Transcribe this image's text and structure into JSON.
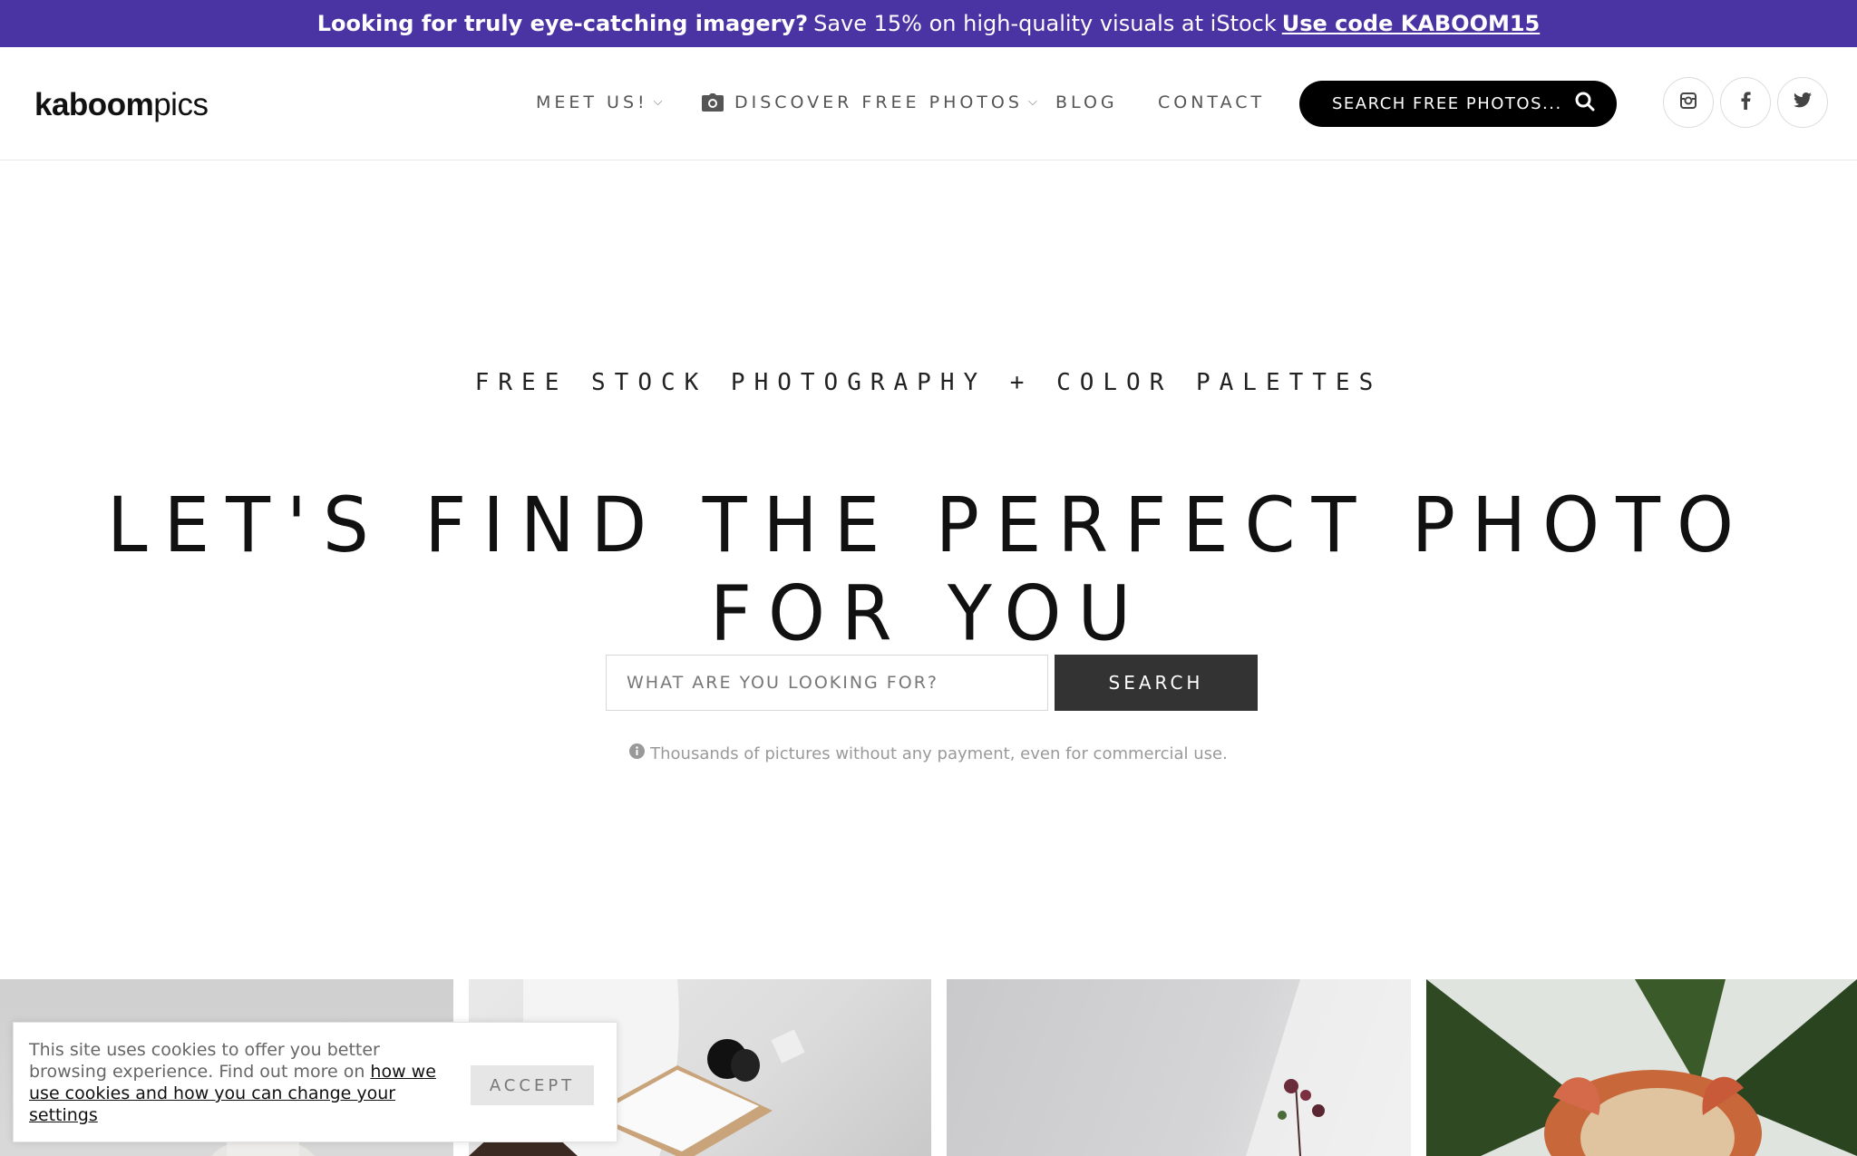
{
  "promo": {
    "bold_text": "Looking for truly eye-catching imagery?",
    "text": "Save 15% on high-quality visuals at iStock",
    "code_link": "Use code KABOOM15"
  },
  "logo": {
    "bold": "kaboom",
    "light": "pics"
  },
  "nav": {
    "meet_us": "MEET US!",
    "discover": "DISCOVER FREE PHOTOS",
    "blog": "BLOG",
    "contact": "CONTACT"
  },
  "header_search": {
    "label": "SEARCH FREE PHOTOS..."
  },
  "hero": {
    "tagline": "FREE STOCK PHOTOGRAPHY + COLOR PALETTES",
    "headline": "LET'S FIND THE PERFECT PHOTO FOR YOU",
    "search_placeholder": "WHAT ARE YOU LOOKING FOR?",
    "search_value": "",
    "search_button": "SEARCH",
    "note": "Thousands of pictures without any payment, even for commercial use."
  },
  "cookie": {
    "text": "This site uses cookies to offer you better browsing experience. Find out more on",
    "link": "how we use cookies and how you can change your settings",
    "accept": "ACCEPT"
  },
  "social": [
    "instagram-icon",
    "facebook-icon",
    "twitter-icon"
  ],
  "colors": {
    "promo_bg": "#4a33a3",
    "search_btn": "#333333",
    "header_search_bg": "#000000"
  }
}
